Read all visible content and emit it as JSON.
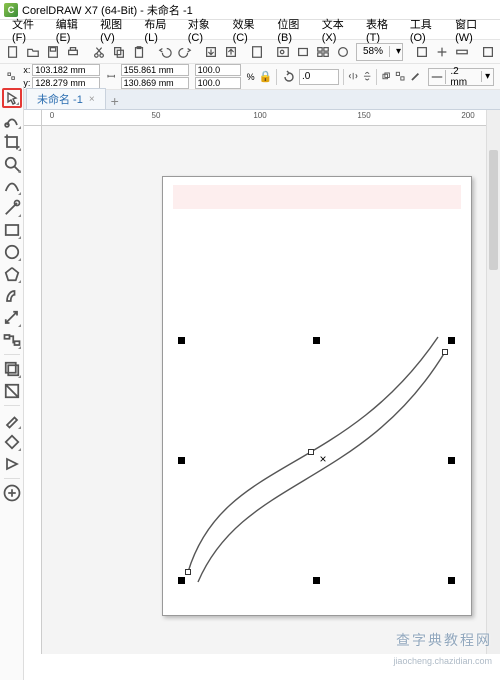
{
  "app": {
    "title": "CorelDRAW X7 (64-Bit) - 未命名 -1",
    "icon_letter": "C"
  },
  "menu": {
    "file": "文件(F)",
    "edit": "编辑(E)",
    "view": "视图(V)",
    "layout": "布局(L)",
    "object": "对象(C)",
    "effects": "效果(C)",
    "bitmap": "位图(B)",
    "text": "文本(X)",
    "table": "表格(T)",
    "tools": "工具(O)",
    "window": "窗口(W)"
  },
  "zoom": {
    "value": "58%"
  },
  "propbar": {
    "x_label": "x:",
    "y_label": "y:",
    "x": "103.182 mm",
    "y": "128.279 mm",
    "w": "155.861 mm",
    "h": "130.869 mm",
    "sx": "100.0",
    "sy": "100.0",
    "pct": "%",
    "rotation": ".0",
    "outline_width": ".2 mm"
  },
  "doc_tab": {
    "label": "未命名 -1"
  },
  "ruler": {
    "t0": "0",
    "t50": "50",
    "t100": "100",
    "t150": "150",
    "t200": "200"
  },
  "watermark": {
    "line1": "查字典教程网",
    "line2": "jiaocheng.chazidian.com"
  }
}
